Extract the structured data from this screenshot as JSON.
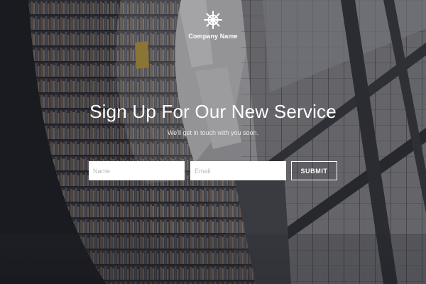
{
  "brand": {
    "icon": "ship-wheel-icon",
    "name": "Company Name"
  },
  "hero": {
    "headline": "Sign Up For Our New Service",
    "subline": "We'll get in touch with you soon."
  },
  "form": {
    "name_placeholder": "Name",
    "email_placeholder": "Email",
    "submit_label": "SUBMIT"
  },
  "colors": {
    "text": "#ffffff",
    "field_background": "#ffffff",
    "placeholder": "#b9b9b9",
    "overlay": "#191b21"
  },
  "background": {
    "subject": "library-bookshelves-photo"
  }
}
